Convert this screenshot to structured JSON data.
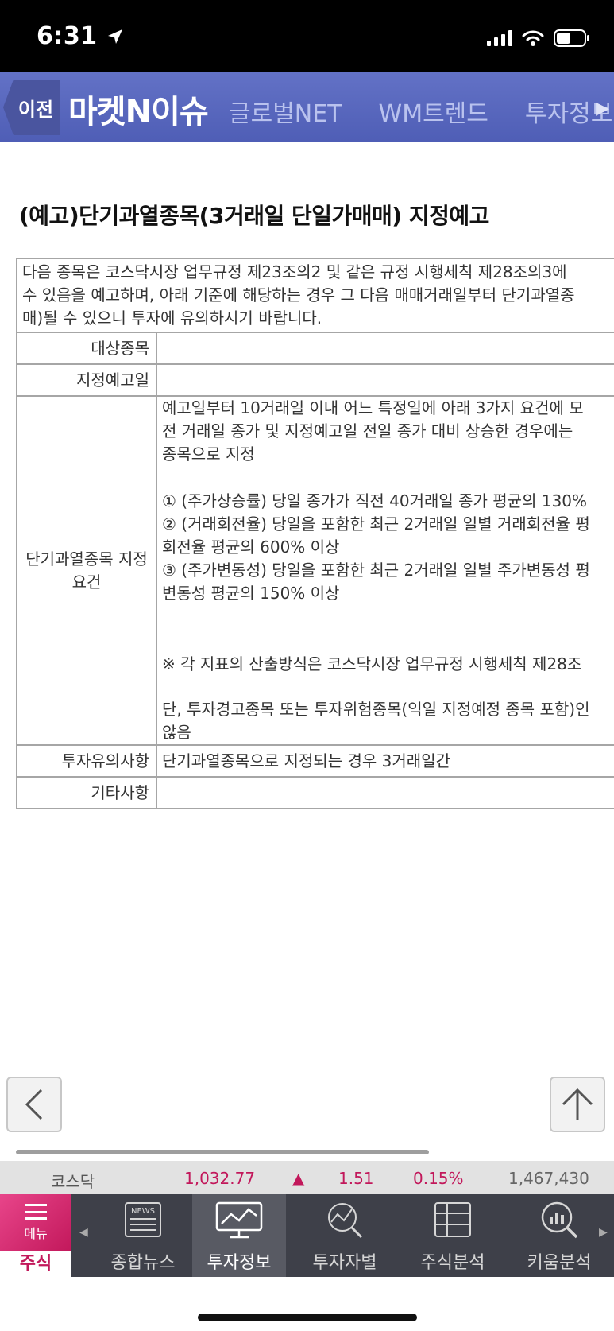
{
  "status": {
    "time": "6:31"
  },
  "nav": {
    "back_label": "이전",
    "title": "마켓N이슈",
    "tabs": [
      "글로벌NET",
      "WM트렌드",
      "투자정보알림"
    ]
  },
  "article": {
    "heading": "(예고)단기과열종목(3거래일 단일가매매) 지정예고",
    "intro_lines": [
      "다음 종목은 코스닥시장 업무규정 제23조의2 및 같은 규정 시행세칙 제28조의3에",
      "수 있음을 예고하며, 아래 기준에 해당하는 경우 그 다음 매매거래일부터 단기과열종",
      "매)될 수 있으니 투자에 유의하시기 바랍니다."
    ],
    "rows": {
      "target_label": "대상종목",
      "target_value": "",
      "date_label": "지정예고일",
      "date_value": "",
      "req_label": "단기과열종목 지정 요건",
      "req_lines_1": [
        "예고일부터 10거래일 이내 어느 특정일에 아래 3가지 요건에 모",
        "전 거래일 종가 및 지정예고일 전일 종가 대비 상승한 경우에는 ",
        "종목으로 지정"
      ],
      "req_lines_2": [
        "① (주가상승률) 당일 종가가 직전 40거래일 종가 평균의 130%",
        "② (거래회전율) 당일을 포함한 최근 2거래일 일별 거래회전율 평",
        "회전율 평균의 600% 이상",
        "③ (주가변동성) 당일을 포함한 최근 2거래일 일별 주가변동성 평",
        "변동성 평균의 150% 이상"
      ],
      "req_note": "※ 각 지표의 산출방식은 코스닥시장 업무규정 시행세칙 제28조",
      "req_exception_lines": [
        "단, 투자경고종목 또는 투자위험종목(익일 지정예정 종목 포함)인",
        "않음"
      ],
      "caution_label": "투자유의사항",
      "caution_value": "단기과열종목으로 지정되는 경우 3거래일간",
      "etc_label": "기타사항",
      "etc_value": ""
    }
  },
  "ticker": {
    "name": "코스닥",
    "price": "1,032.77",
    "arrow": "▲",
    "change": "1.51",
    "rate": "0.15%",
    "volume": "1,467,430"
  },
  "bottom_nav": {
    "menu_label": "메뉴",
    "menu_sub": "주식",
    "tabs": [
      {
        "label": "종합뉴스",
        "icon": "news-icon"
      },
      {
        "label": "투자정보",
        "icon": "chart-monitor-icon"
      },
      {
        "label": "투자자별",
        "icon": "investor-chart-icon"
      },
      {
        "label": "주식분석",
        "icon": "table-icon"
      },
      {
        "label": "키움분석",
        "icon": "analysis-search-icon"
      }
    ]
  },
  "colors": {
    "nav_bg": "#5866bb",
    "accent_pink": "#c2185b",
    "bottom_bg": "#3e4049"
  }
}
